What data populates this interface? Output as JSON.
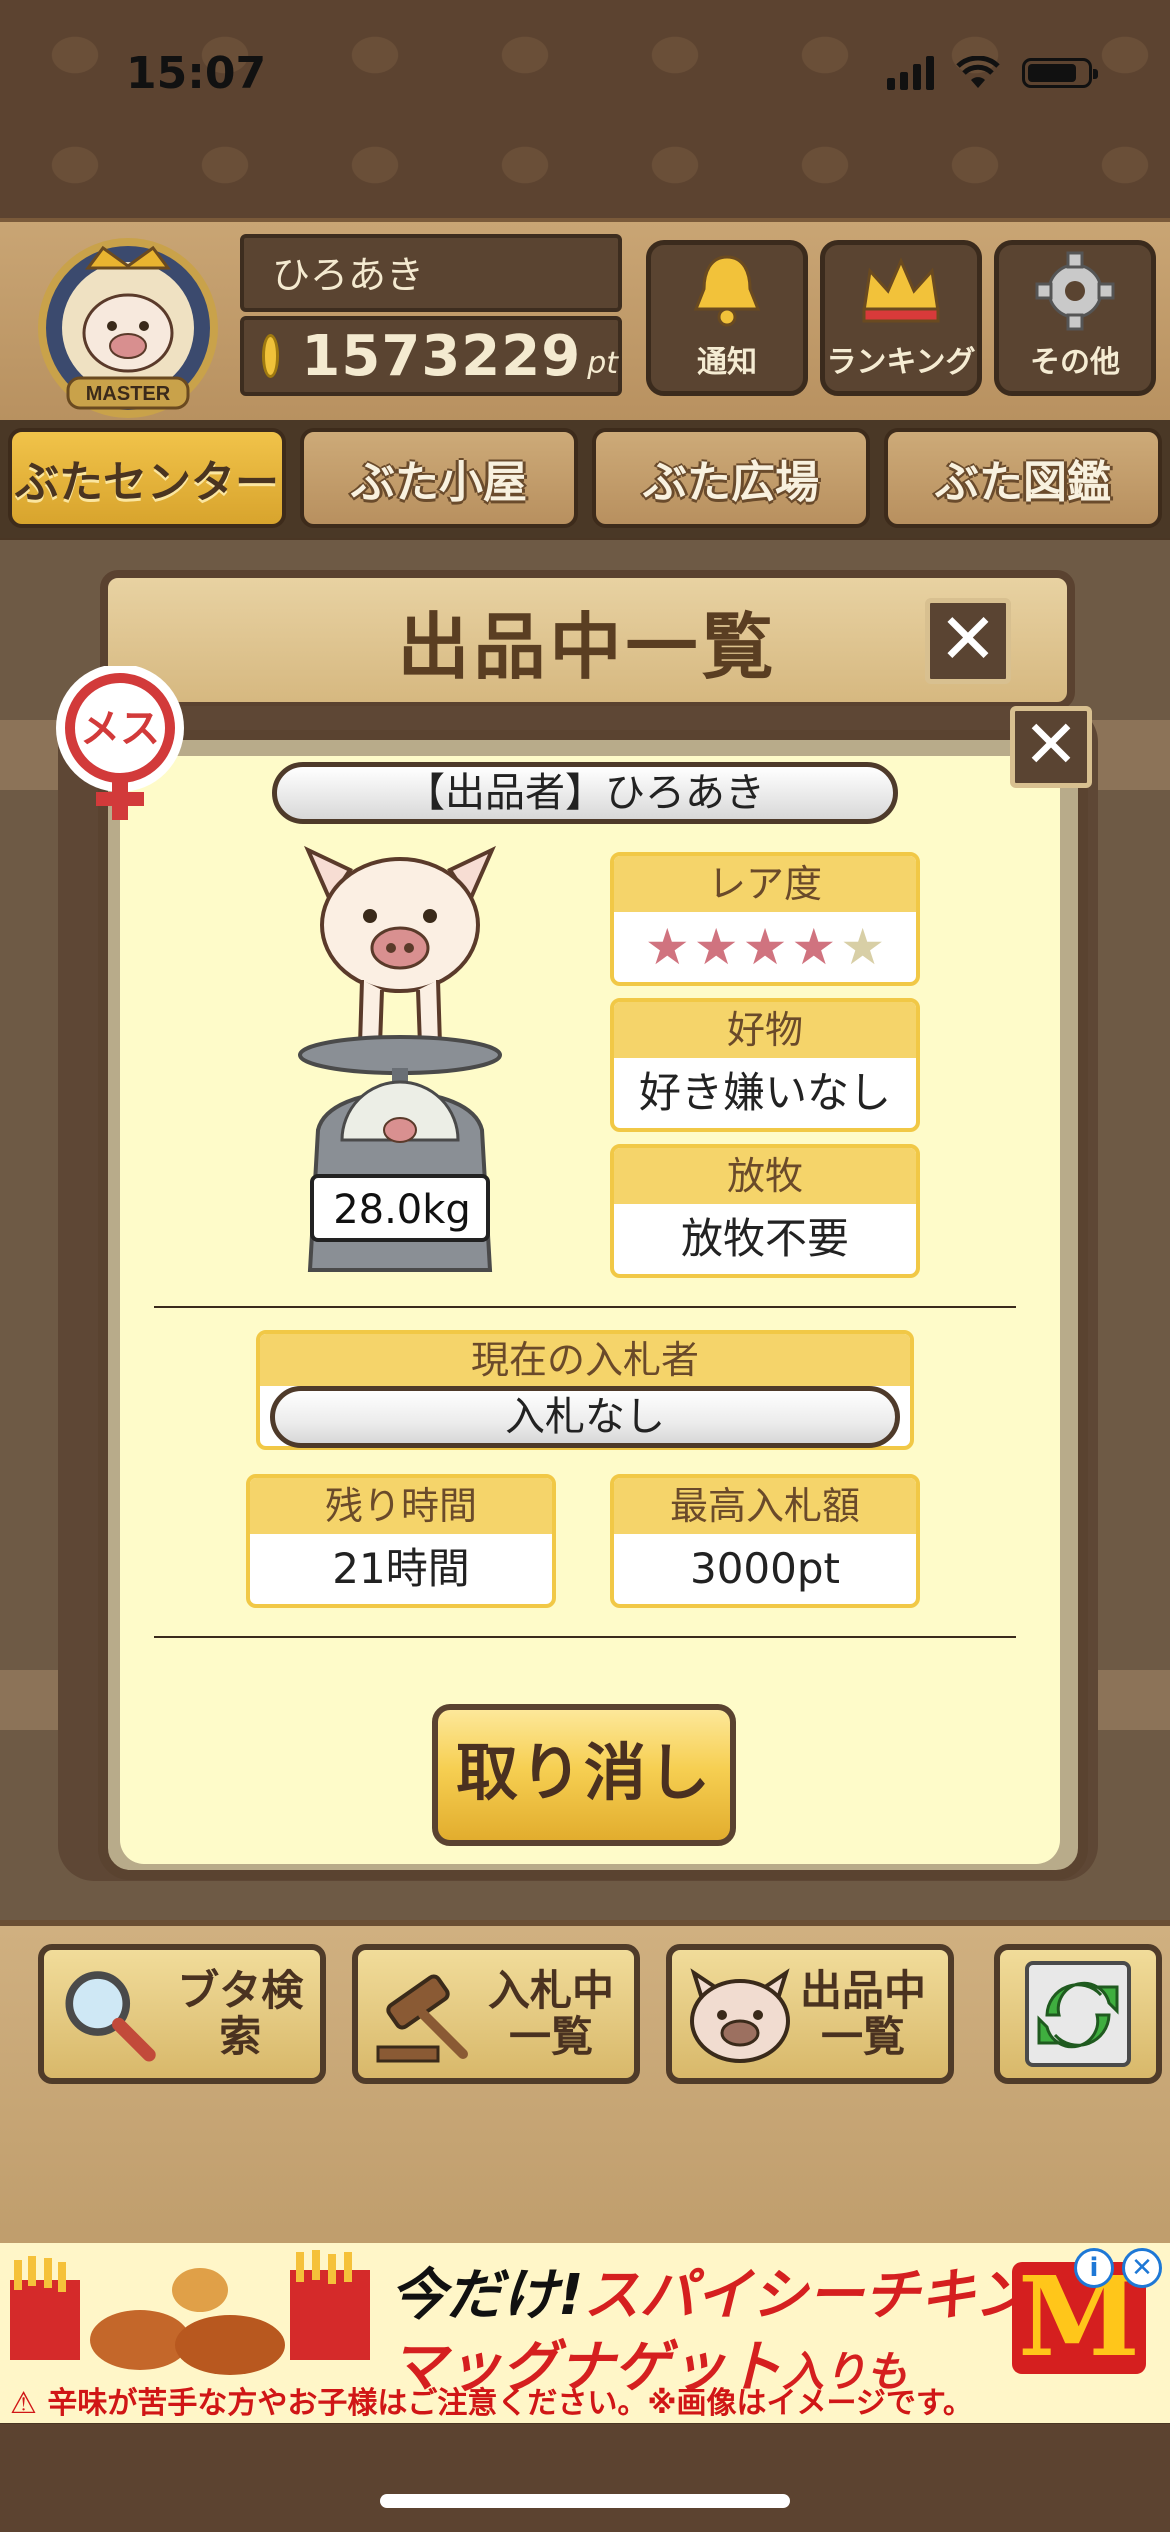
{
  "status_bar": {
    "time": "15:07"
  },
  "header": {
    "badge_text": "MASTER",
    "user_name": "ひろあき",
    "points": "1573229",
    "points_unit": "pt",
    "buttons": [
      {
        "label": "通知",
        "icon": "bell-icon"
      },
      {
        "label": "ランキング",
        "icon": "crown-icon"
      },
      {
        "label": "その他",
        "icon": "gear-icon"
      }
    ]
  },
  "tabs": [
    "ぶたセンター",
    "ぶた小屋",
    "ぶた広場",
    "ぶた図鑑"
  ],
  "panel": {
    "title": "出品中一覧"
  },
  "listing": {
    "gender_label": "メス",
    "seller": "【出品者】ひろあき",
    "weight": "28.0kg",
    "rarity": {
      "label": "レア度",
      "stars_filled": 4,
      "stars_total": 5
    },
    "favorite": {
      "label": "好物",
      "value": "好き嫌いなし"
    },
    "grazing": {
      "label": "放牧",
      "value": "放牧不要"
    },
    "current_bidder": {
      "label": "現在の入札者",
      "value": "入札なし"
    },
    "time_left": {
      "label": "残り時間",
      "value": "21時間"
    },
    "max_bid": {
      "label": "最高入札額",
      "value": "3000pt"
    },
    "cancel_label": "取り消し"
  },
  "toolbar": {
    "search_label": "ブタ検索",
    "bidding_label_1": "入札中",
    "bidding_label_2": "一覧",
    "listing_label_1": "出品中",
    "listing_label_2": "一覧"
  },
  "ad": {
    "line1_a": "今だけ!",
    "line1_b": "スパイシーチキン",
    "line2_a": "マッグナゲット",
    "line2_b": "入りも",
    "note": "辛味が苦手な方やお子様はご注意ください。※画像はイメージです。",
    "logo": "M"
  },
  "colors": {
    "accent": "#f5d46a",
    "panel_bg": "#fefbc9",
    "star_on": "#d0737f",
    "star_off": "#d8cfa6",
    "ad_red": "#d51f1f"
  }
}
